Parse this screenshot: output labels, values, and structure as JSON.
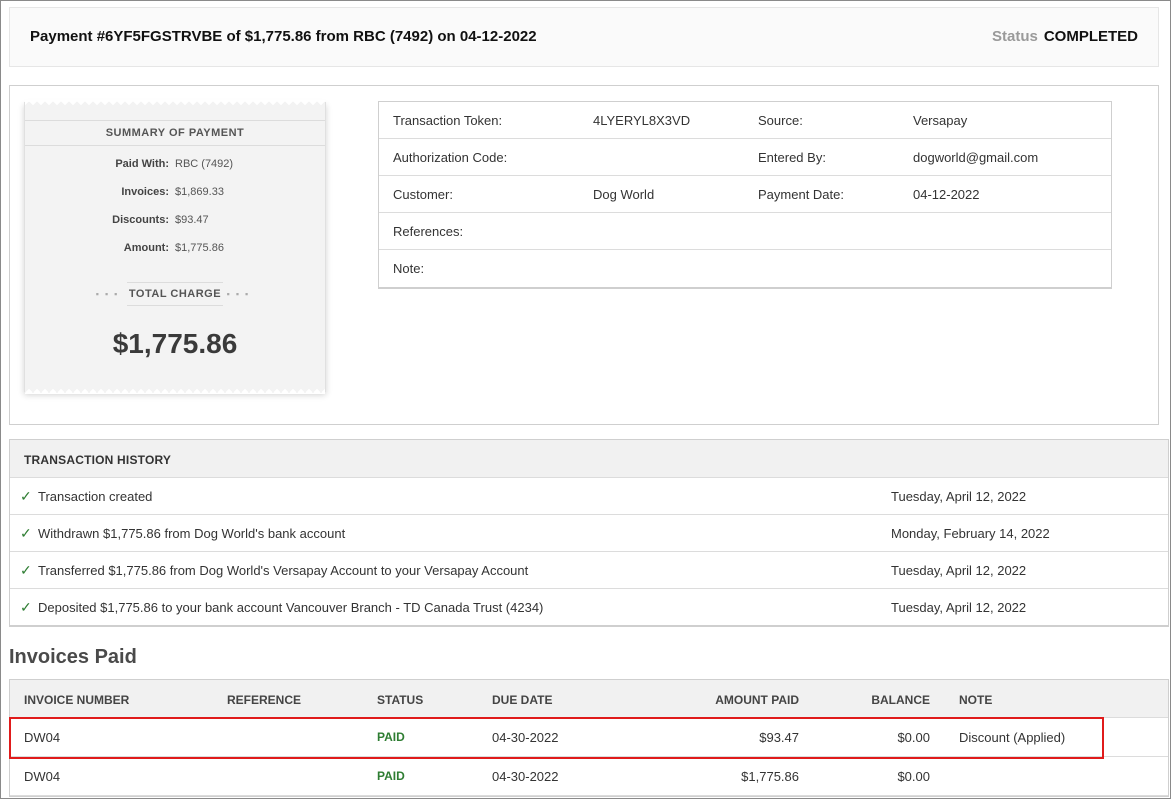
{
  "header": {
    "title": "Payment #6YF5FGSTRVBE of $1,775.86 from RBC (7492) on 04-12-2022",
    "status_label": "Status",
    "status_value": "COMPLETED"
  },
  "receipt": {
    "title": "SUMMARY OF PAYMENT",
    "rows": [
      {
        "label": "Paid With:",
        "value": "RBC (7492)"
      },
      {
        "label": "Invoices:",
        "value": "$1,869.33"
      },
      {
        "label": "Discounts:",
        "value": "$93.47"
      },
      {
        "label": "Amount:",
        "value": "$1,775.86"
      }
    ],
    "total_label": "TOTAL CHARGE",
    "total_amount": "$1,775.86"
  },
  "details": {
    "rows": [
      {
        "l1": "Transaction Token:",
        "v1": "4LYERYL8X3VD",
        "l2": "Source:",
        "v2": "Versapay"
      },
      {
        "l1": "Authorization Code:",
        "v1": "",
        "l2": "Entered By:",
        "v2": "dogworld@gmail.com"
      },
      {
        "l1": "Customer:",
        "v1": "Dog World",
        "l2": "Payment Date:",
        "v2": "04-12-2022"
      },
      {
        "l1": "References:",
        "v1": "",
        "l2": "",
        "v2": ""
      },
      {
        "l1": "Note:",
        "v1": "",
        "l2": "",
        "v2": ""
      }
    ]
  },
  "history": {
    "title": "TRANSACTION HISTORY",
    "items": [
      {
        "text": "Transaction created",
        "date": "Tuesday, April 12, 2022"
      },
      {
        "text": "Withdrawn $1,775.86 from Dog World's bank account",
        "date": "Monday, February 14, 2022"
      },
      {
        "text": "Transferred $1,775.86 from Dog World's Versapay Account to your Versapay Account",
        "date": "Tuesday, April 12, 2022"
      },
      {
        "text": "Deposited $1,775.86 to your bank account Vancouver Branch - TD Canada Trust (4234)",
        "date": "Tuesday, April 12, 2022"
      }
    ]
  },
  "invoices": {
    "title": "Invoices Paid",
    "columns": [
      "INVOICE NUMBER",
      "REFERENCE",
      "STATUS",
      "DUE DATE",
      "AMOUNT PAID",
      "BALANCE",
      "NOTE"
    ],
    "rows": [
      {
        "invoice": "DW04",
        "reference": "",
        "status": "PAID",
        "due": "04-30-2022",
        "amount": "$93.47",
        "balance": "$0.00",
        "note": "Discount (Applied)"
      },
      {
        "invoice": "DW04",
        "reference": "",
        "status": "PAID",
        "due": "04-30-2022",
        "amount": "$1,775.86",
        "balance": "$0.00",
        "note": ""
      }
    ]
  },
  "colors": {
    "paid_status": "#2e7d32",
    "check_icon": "#2e7d32",
    "highlight_border": "#e01b1b"
  }
}
